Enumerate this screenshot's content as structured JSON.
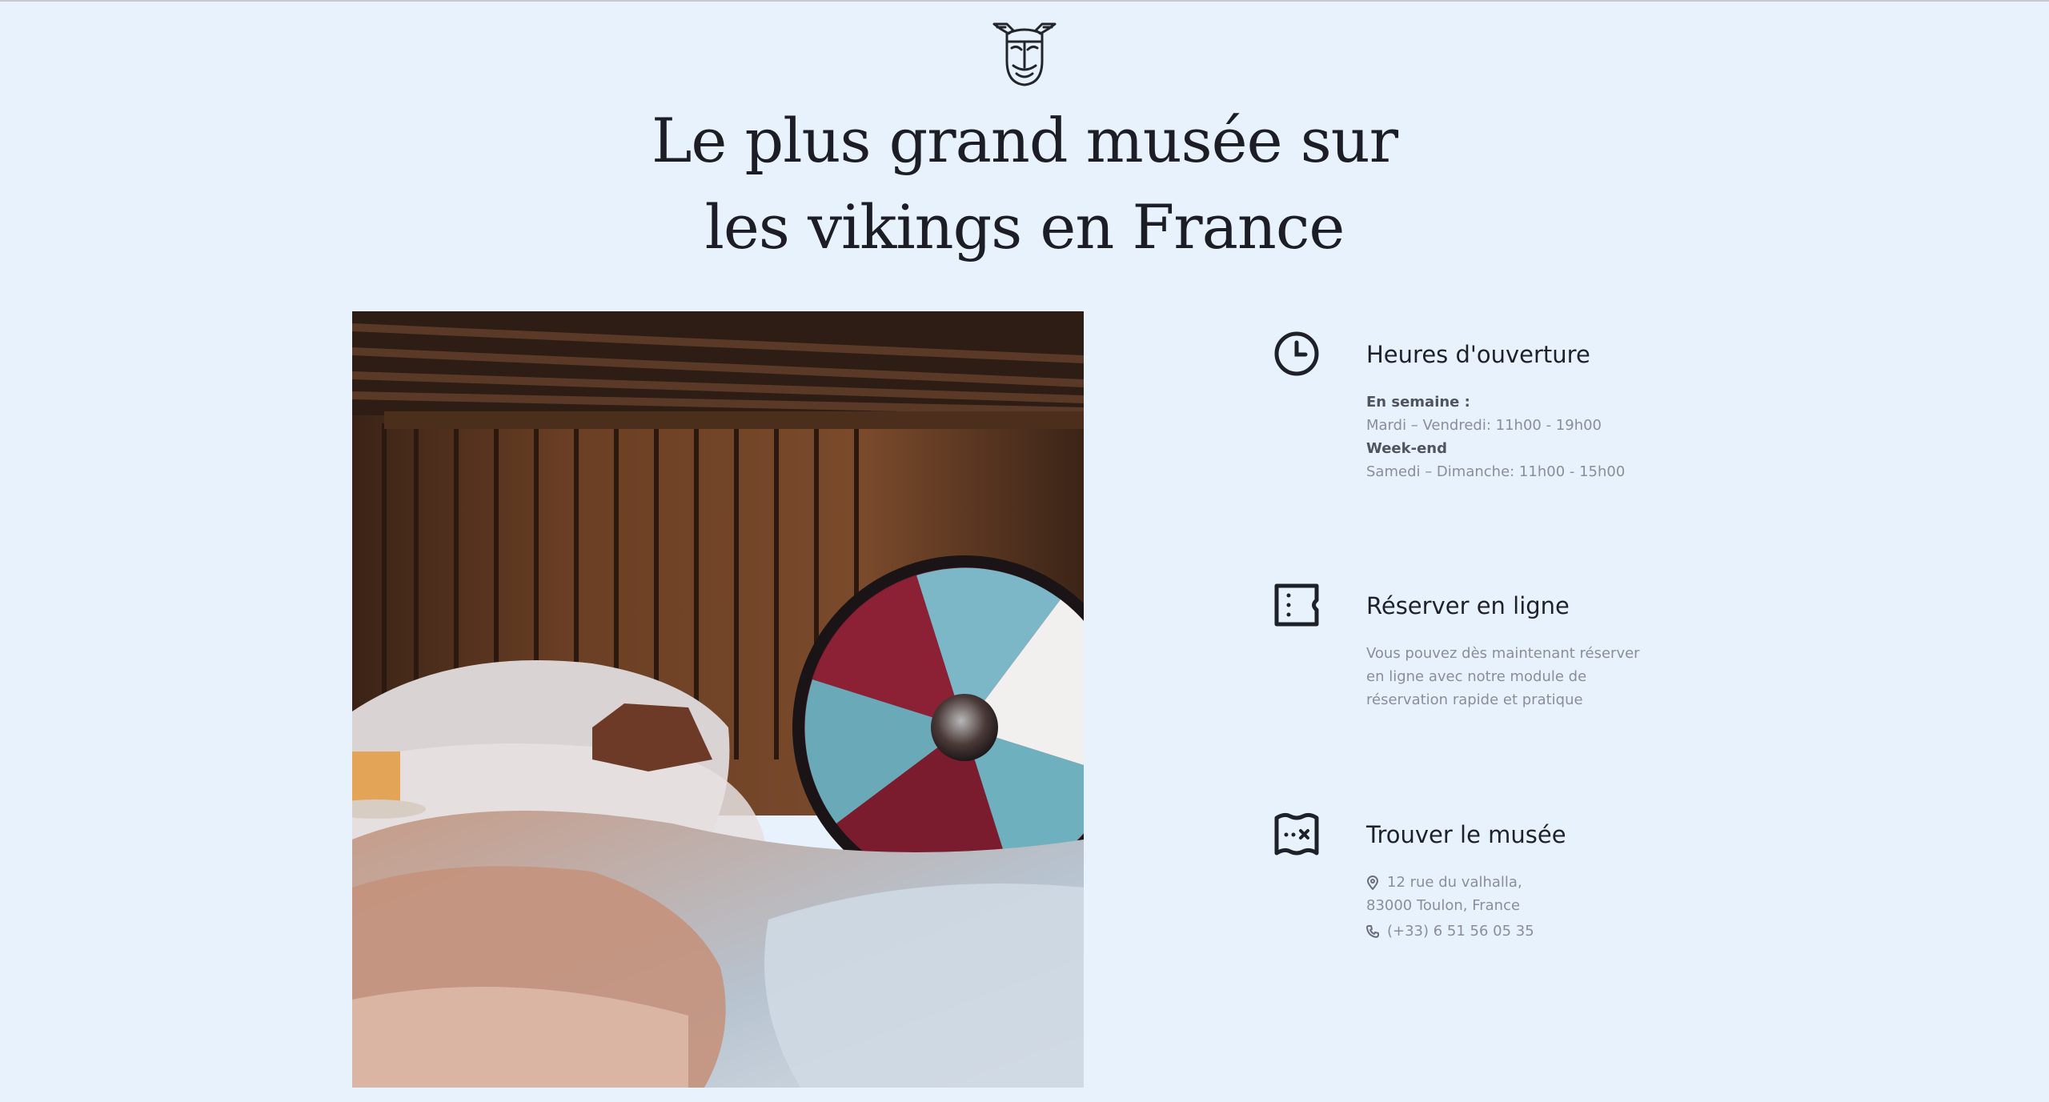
{
  "hero": {
    "title_line1": "Le plus grand musée sur",
    "title_line2": "les vikings en France"
  },
  "hours": {
    "title": "Heures d'ouverture",
    "weekday_label": "En semaine :",
    "weekday_value": "Mardi – Vendredi: 11h00 - 19h00",
    "weekend_label": "Week-end",
    "weekend_value": "Samedi – Dimanche: 11h00 - 15h00"
  },
  "booking": {
    "title": "Réserver en ligne",
    "line1": "Vous pouvez dès maintenant réserver",
    "line2": "en ligne avec notre module de",
    "line3": "réservation rapide et pratique"
  },
  "location": {
    "title": "Trouver le musée",
    "address_line1": "12 rue du valhalla,",
    "address_line2": "83000 Toulon, France",
    "phone": "(+33) 6 51 56 05 35"
  },
  "icons": {
    "logo": "viking-helmet-logo",
    "hours": "clock-icon",
    "booking": "ticket-icon",
    "location": "map-icon",
    "address": "map-pin-icon",
    "phone": "phone-icon"
  },
  "colors": {
    "background": "#e8f2fd",
    "heading": "#1c1d25",
    "body_text": "#8a8e96"
  }
}
